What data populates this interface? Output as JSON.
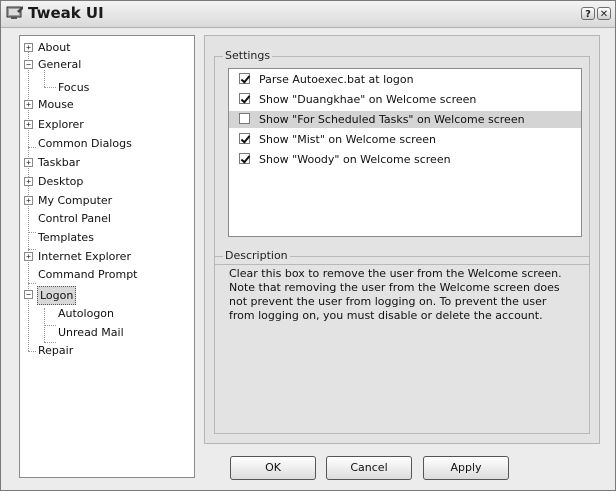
{
  "window": {
    "title": "Tweak UI"
  },
  "titlebar": {
    "help_glyph": "?",
    "close_glyph": "✕"
  },
  "tree": {
    "items": [
      {
        "label": "About",
        "expander": "+"
      },
      {
        "label": "General",
        "expander": "−"
      },
      {
        "label": "Focus"
      },
      {
        "label": "Mouse",
        "expander": "+"
      },
      {
        "label": "Explorer",
        "expander": "+"
      },
      {
        "label": "Common Dialogs"
      },
      {
        "label": "Taskbar",
        "expander": "+"
      },
      {
        "label": "Desktop",
        "expander": "+"
      },
      {
        "label": "My Computer",
        "expander": "+"
      },
      {
        "label": "Control Panel"
      },
      {
        "label": "Templates"
      },
      {
        "label": "Internet Explorer",
        "expander": "+"
      },
      {
        "label": "Command Prompt"
      },
      {
        "label": "Logon",
        "expander": "−",
        "selected": true
      },
      {
        "label": "Autologon"
      },
      {
        "label": "Unread Mail"
      },
      {
        "label": "Repair"
      }
    ]
  },
  "settings": {
    "group_label": "Settings",
    "items": [
      {
        "label": "Parse Autoexec.bat at logon",
        "checked": true
      },
      {
        "label": "Show \"Duangkhae\" on Welcome screen",
        "checked": true
      },
      {
        "label": "Show \"For Scheduled Tasks\" on Welcome screen",
        "checked": false,
        "highlighted": true
      },
      {
        "label": "Show \"Mist\" on Welcome screen",
        "checked": true
      },
      {
        "label": "Show \"Woody\" on Welcome screen",
        "checked": true
      }
    ]
  },
  "description": {
    "group_label": "Description",
    "lines": [
      "Clear this box to remove the user from the Welcome screen.",
      "Note that removing the user from the Welcome screen does",
      "not prevent the user from logging on.  To prevent the user",
      "from logging on, you must disable or delete the account."
    ]
  },
  "buttons": {
    "ok": "OK",
    "cancel": "Cancel",
    "apply": "Apply"
  }
}
